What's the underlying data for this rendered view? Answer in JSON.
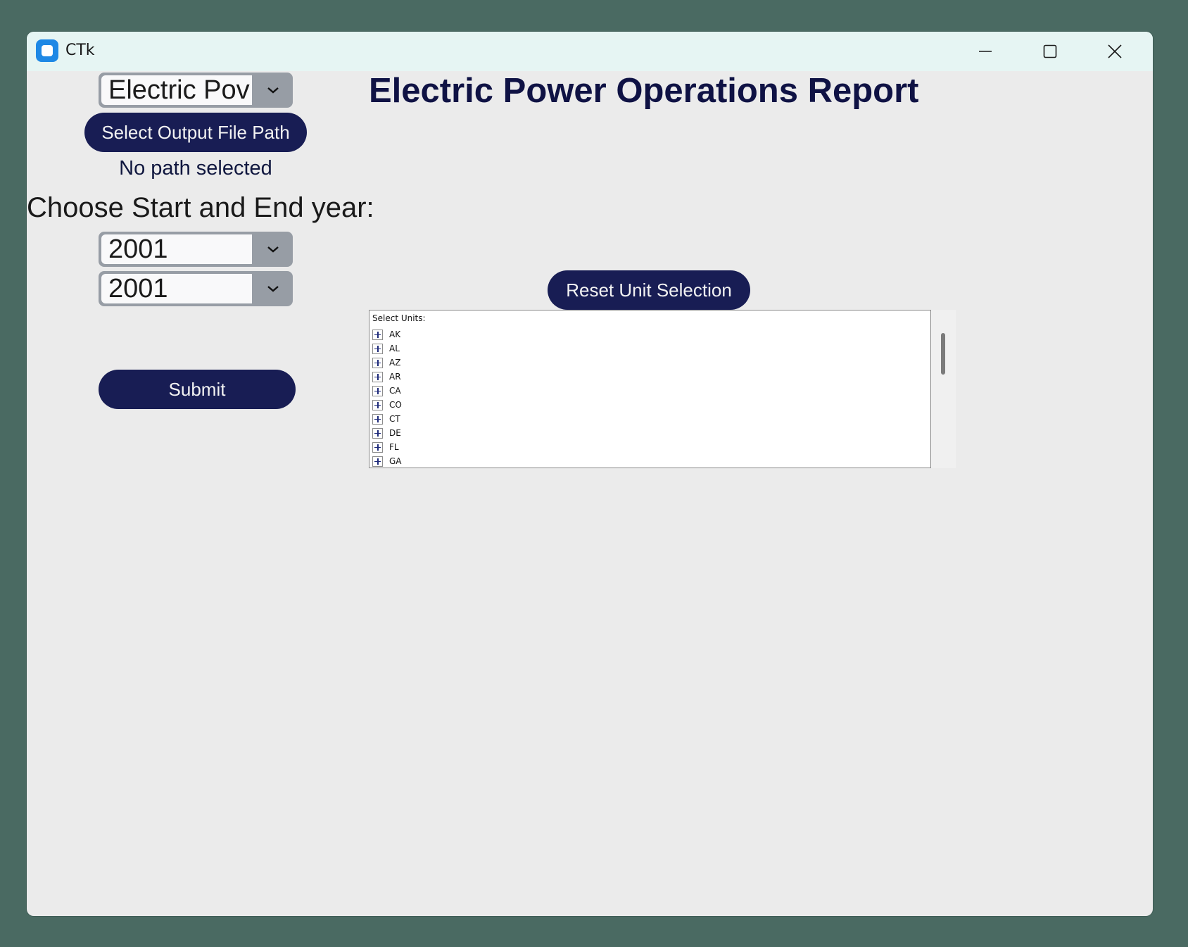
{
  "window": {
    "title": "CTk"
  },
  "report_dropdown": {
    "value": "Electric Pov"
  },
  "output_button": {
    "label": "Select Output File Path"
  },
  "path_status": "No path selected",
  "year_prompt": "Choose Start and End year:",
  "start_year": {
    "value": "2001"
  },
  "end_year": {
    "value": "2001"
  },
  "submit_button": {
    "label": "Submit"
  },
  "heading": "Electric Power Operations Report",
  "reset_button": {
    "label": "Reset Unit Selection"
  },
  "units_tree": {
    "title": "Select Units:",
    "items": [
      "AK",
      "AL",
      "AZ",
      "AR",
      "CA",
      "CO",
      "CT",
      "DE",
      "FL",
      "GA"
    ]
  },
  "colors": {
    "button_bg": "#181d54",
    "heading": "#0f1244",
    "window_bg": "#ebebeb",
    "titlebar": "#e6f5f3",
    "desktop": "#4a6a62"
  },
  "icons": {
    "app": "ctk-app-icon",
    "minimize": "minimize-icon",
    "maximize": "maximize-icon",
    "close": "close-icon",
    "dropdown": "chevron-down-icon",
    "expand": "plus-expander-icon"
  }
}
